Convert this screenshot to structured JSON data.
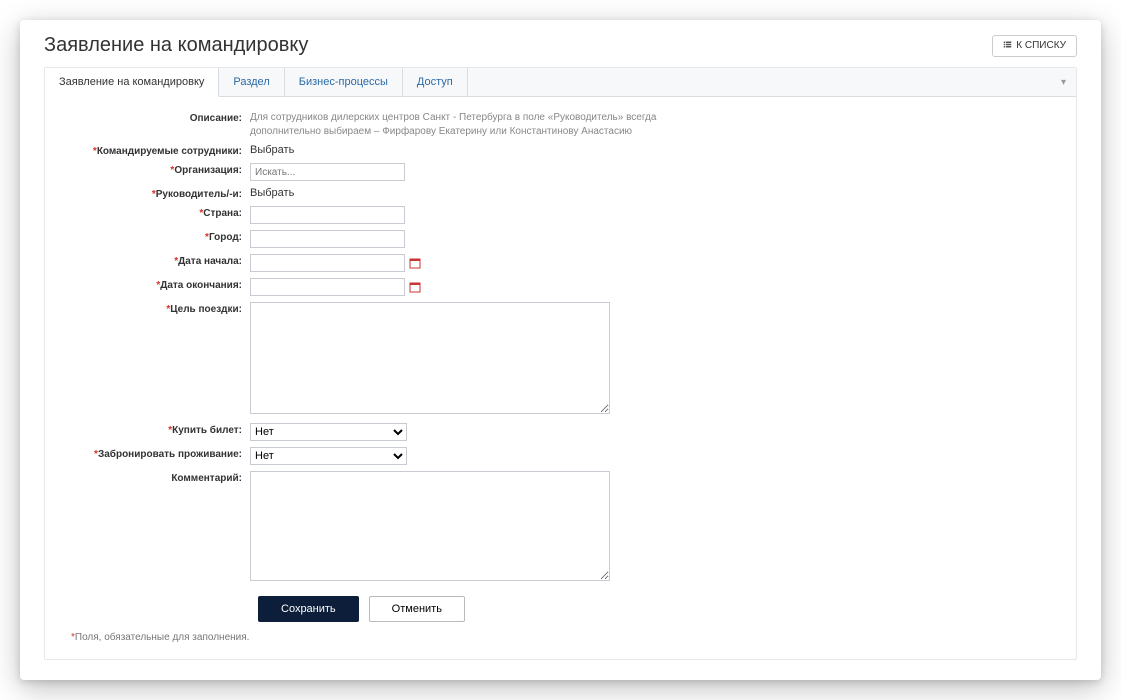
{
  "header": {
    "title": "Заявление на командировку",
    "back_label": "К СПИСКУ"
  },
  "tabs": {
    "items": [
      {
        "label": "Заявление на командировку",
        "active": true
      },
      {
        "label": "Раздел",
        "active": false
      },
      {
        "label": "Бизнес-процессы",
        "active": false
      },
      {
        "label": "Доступ",
        "active": false
      }
    ]
  },
  "form": {
    "description_label": "Описание:",
    "description_text": "Для сотрудников дилерских центров Санкт - Петербурга в поле «Руководитель» всегда дополнительно выбираем – Фирфарову Екатерину или Константинову Анастасию",
    "employees_label": "Командируемые сотрудники:",
    "employees_action": "Выбрать",
    "org_label": "Организация:",
    "org_placeholder": "Искать...",
    "managers_label": "Руководитель/-и:",
    "managers_action": "Выбрать",
    "country_label": "Страна:",
    "country_value": "",
    "city_label": "Город:",
    "city_value": "",
    "start_label": "Дата начала:",
    "start_value": "",
    "end_label": "Дата окончания:",
    "end_value": "",
    "purpose_label": "Цель поездки:",
    "purpose_value": "",
    "ticket_label": "Купить билет:",
    "ticket_value": "Нет",
    "booking_label": "Забронировать проживание:",
    "booking_value": "Нет",
    "comment_label": "Комментарий:",
    "comment_value": "",
    "select_options": [
      "Нет"
    ]
  },
  "buttons": {
    "save": "Сохранить",
    "cancel": "Отменить"
  },
  "footnote": "Поля, обязательные для заполнения."
}
